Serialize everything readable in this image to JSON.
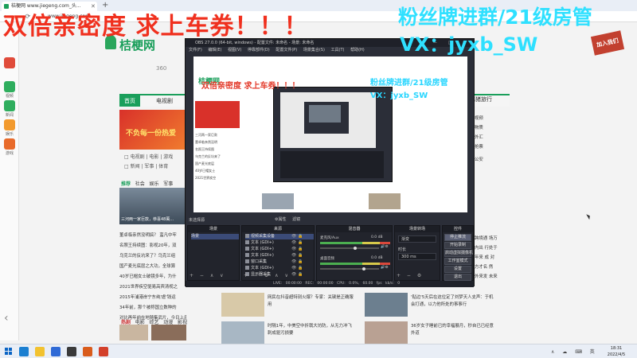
{
  "browser": {
    "tab_title": "桔梗网 www.jiegeng.com_头...",
    "tab_close": "✕",
    "tab_add": "+",
    "url": "www.jiegeng.com",
    "nav_icons": "‹ › ⟳"
  },
  "overlay": {
    "red_text": "双倍亲密度 求上车券！！！",
    "cyan_line1": "粉丝牌进群/21级房管",
    "cyan_line2": "VX：jyxb_SW"
  },
  "left_toolbar": {
    "items": [
      {
        "label": "",
        "color": "#e04b3a"
      },
      {
        "label": "视频",
        "color": "#2fae5e"
      },
      {
        "label": "新闻",
        "color": "#2fae5e"
      },
      {
        "label": "娱乐",
        "color": "#f29a2e"
      },
      {
        "label": "游戏",
        "color": "#e86a2a"
      }
    ],
    "arrow": "‹"
  },
  "site": {
    "logo": "桔梗网",
    "subtitle": "360",
    "nav": [
      "首页",
      "电视剧"
    ],
    "nav_right": "飞猪旅行",
    "banner_text": "不负每一份热爱",
    "cat_row1": "□ 电视剧 | 电影 | 游戏",
    "cat_row2": "□ 新闻 | 军事 | 体育",
    "section_tabs": [
      "推荐",
      "社会",
      "娱乐",
      "军事"
    ],
    "news_caption": "三河两一家巨款，恭喜48萬...",
    "news_list": [
      "董卓临亲然没明搞？ 蛮凡中牢",
      "名照王持续图：影视20年，双",
      "乌克兰的反坑来了？乌克兰组",
      "国产麦光底层之大功，全球算",
      "40岁已帽女士破镜多年，为什",
      "2021世界疾空驱易高宾清视之",
      "2015年浦港岸宁东纯'虐'钱运",
      "34年前，那个被称国立数种的",
      "对比再年前在地随集武片，今日上海与"
    ],
    "bottom_tabs": [
      "热剧",
      "电影",
      "综艺",
      "动漫",
      "影视"
    ],
    "feed": [
      {
        "t1": "网民在抖音超特别火爆？专家：关键是正确服用",
        "s1": "",
        "t2": "'贴边'5天后在这位定了刘梦天人支声：于机会打通，以力他所处的事事行",
        "s2": ""
      },
      {
        "t1": "时隔1年，中美空中折戟大坊防，从无力冲飞刺成驱污损要",
        "s1": "",
        "t2": "36岁女子睡前已的幸福展月，秒自已已经意外道",
        "s2": ""
      }
    ],
    "right_col": [
      "视频",
      "物质",
      "外汇",
      "抢票",
      "公安"
    ],
    "right_col2": [
      "跨境通 场万",
      "内出 行处于",
      "年来 成 对",
      "方才名 然",
      "外来发 未来"
    ],
    "sticker": "加入我们"
  },
  "obs": {
    "title": "OBS 27.0.0 (64-bit, windows) - 配置文件: 未命名 - 场景: 未命名",
    "window_controls": "— □ ✕",
    "menu": [
      "文件(F)",
      "编辑(E)",
      "视图(V)",
      "停靠部件(D)",
      "配置文件(P)",
      "场景集合(S)",
      "工具(T)",
      "帮助(H)"
    ],
    "no_source": "未选择源",
    "prop_buttons": [
      "⚙属性",
      "滤镜"
    ],
    "preview_overlay_red": "双倍亲密度 求上车券！！！",
    "preview_overlay_cyan1": "粉丝牌进群/21级房管",
    "preview_overlay_cyan2": "VX：jyxb_SW",
    "preview_logo": "桔梗网",
    "preview_list": [
      "三河两一家巨款",
      "董卓临亲然没明",
      "名照王持续图",
      "乌克兰的反坑来了",
      "国产麦光底层",
      "40岁已帽女士",
      "2021世界疾空"
    ],
    "docks": {
      "scenes": {
        "title": "场景",
        "items": [
          "场景"
        ],
        "footer": "+ − ∧ ∨"
      },
      "sources": {
        "title": "来源",
        "items": [
          {
            "name": "视频采集设备",
            "selected": true
          },
          {
            "name": "文本 (GDI+)",
            "selected": false
          },
          {
            "name": "文本 (GDI+)",
            "selected": false
          },
          {
            "name": "文本 (GDI+)",
            "selected": false
          },
          {
            "name": "窗口采集",
            "selected": false
          },
          {
            "name": "文本 (GDI+)",
            "selected": false
          },
          {
            "name": "显示器采集",
            "selected": false
          }
        ],
        "footer": "+ − ⚙ ∧ ∨"
      },
      "mixer": {
        "title": "混音器",
        "channels": [
          {
            "name": "麦克风/Aux",
            "db": "0.0 dB",
            "level": 0.6
          },
          {
            "name": "桌面音频",
            "db": "0.0 dB",
            "level": 0.75
          }
        ]
      },
      "transitions": {
        "title": "场景转场",
        "type": "渐变",
        "duration_label": "时长",
        "duration": "300 ms",
        "footer": "+ − ⚙"
      },
      "controls": {
        "title": "控件",
        "buttons": [
          {
            "label": "停止推流",
            "on": true
          },
          {
            "label": "开始录制",
            "on": false
          },
          {
            "label": "启动虚拟摄像机",
            "on": false
          },
          {
            "label": "工作室模式",
            "on": false
          },
          {
            "label": "设置",
            "on": false
          },
          {
            "label": "退出",
            "on": false
          }
        ]
      }
    },
    "status": {
      "live": "LIVE: 00:00:00",
      "rec": "REC: 00:00:00",
      "cpu": "CPU: 0.0%, 60.00 fps",
      "kbps": "kb/s: 0"
    }
  },
  "taskbar": {
    "tray": "∧ ☁ ⌨ 英",
    "time": "18:31",
    "date": "2022/4/5",
    "apps": [
      {
        "name": "edge",
        "color": "#1b7fd1"
      },
      {
        "name": "explorer",
        "color": "#f2c230"
      },
      {
        "name": "store",
        "color": "#2f6ad6"
      },
      {
        "name": "obs",
        "color": "#3a3a3a"
      },
      {
        "name": "media",
        "color": "#d95c1c"
      },
      {
        "name": "chrome",
        "color": "#d3402b"
      }
    ]
  },
  "colors": {
    "brand_green": "#1a9f5b",
    "overlay_red": "#f0301e",
    "overlay_cyan": "#2fe0ff",
    "obs_bg": "#2b2e38"
  }
}
